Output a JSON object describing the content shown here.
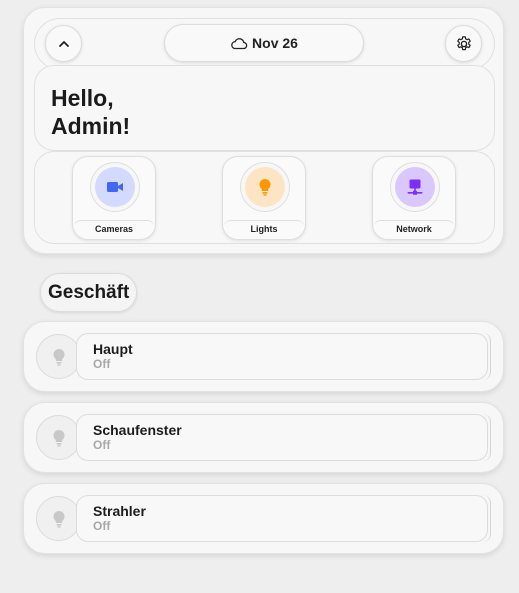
{
  "header": {
    "collapse_icon": "chevron-up-icon",
    "weather_icon": "cloud-icon",
    "date": "Nov 26",
    "settings_icon": "gear-icon"
  },
  "greeting": {
    "line1": "Hello,",
    "line2": "Admin!"
  },
  "shortcuts": [
    {
      "label": "Cameras",
      "icon": "video-camera-icon",
      "color": "#4267f5",
      "bg": "#d3dafd"
    },
    {
      "label": "Lights",
      "icon": "lightbulb-icon",
      "color": "#ff9800",
      "bg": "#fde4c4"
    },
    {
      "label": "Network",
      "icon": "network-icon",
      "color": "#7b2ff7",
      "bg": "#dac7fb"
    }
  ],
  "section": {
    "title": "Geschäft"
  },
  "devices": [
    {
      "name": "Haupt",
      "state": "Off",
      "icon": "lightbulb-icon"
    },
    {
      "name": "Schaufenster",
      "state": "Off",
      "icon": "lightbulb-icon"
    },
    {
      "name": "Strahler",
      "state": "Off",
      "icon": "lightbulb-icon"
    }
  ],
  "colors": {
    "background": "#eeeeee",
    "card": "#f7f7f7",
    "off_icon": "#c8c8c8",
    "off_text": "#a8a8a8"
  }
}
